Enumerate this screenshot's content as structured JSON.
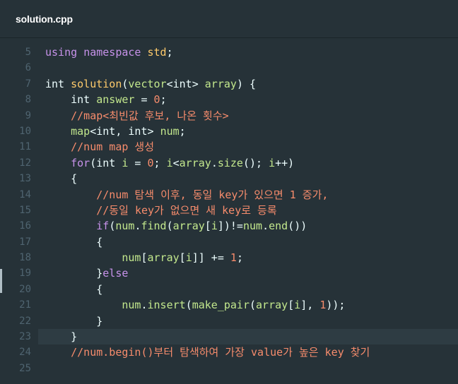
{
  "tab": {
    "title": "solution.cpp"
  },
  "colors": {
    "background": "#263238",
    "keyword": "#c792ea",
    "function": "#ffcb6b",
    "variable": "#c3e88d",
    "number": "#f78c6c",
    "comment": "#f78c6c",
    "line_number": "#4f6470"
  },
  "editor": {
    "current_line": "23",
    "lines": [
      {
        "n": "5",
        "tokens": [
          [
            "kw",
            "using"
          ],
          [
            "pl",
            " "
          ],
          [
            "kw",
            "namespace"
          ],
          [
            "pl",
            " "
          ],
          [
            "ns",
            "std"
          ],
          [
            "p",
            ";"
          ]
        ]
      },
      {
        "n": "6",
        "tokens": []
      },
      {
        "n": "7",
        "tokens": [
          [
            "type",
            "int"
          ],
          [
            "pl",
            " "
          ],
          [
            "fn",
            "solution"
          ],
          [
            "p",
            "("
          ],
          [
            "id",
            "vector"
          ],
          [
            "p",
            "<"
          ],
          [
            "type",
            "int"
          ],
          [
            "p",
            "> "
          ],
          [
            "id",
            "array"
          ],
          [
            "p",
            ") {"
          ]
        ]
      },
      {
        "n": "8",
        "tokens": [
          [
            "pl",
            "    "
          ],
          [
            "type",
            "int"
          ],
          [
            "pl",
            " "
          ],
          [
            "id",
            "answer"
          ],
          [
            "p",
            " = "
          ],
          [
            "num",
            "0"
          ],
          [
            "p",
            ";"
          ]
        ]
      },
      {
        "n": "9",
        "tokens": [
          [
            "pl",
            "    "
          ],
          [
            "cm",
            "//map<최빈값 후보, 나온 횟수>"
          ]
        ]
      },
      {
        "n": "10",
        "tokens": [
          [
            "pl",
            "    "
          ],
          [
            "id",
            "map"
          ],
          [
            "p",
            "<"
          ],
          [
            "type",
            "int"
          ],
          [
            "p",
            ", "
          ],
          [
            "type",
            "int"
          ],
          [
            "p",
            "> "
          ],
          [
            "id",
            "num"
          ],
          [
            "p",
            ";"
          ]
        ]
      },
      {
        "n": "11",
        "tokens": [
          [
            "pl",
            "    "
          ],
          [
            "cm",
            "//num map 생성"
          ]
        ]
      },
      {
        "n": "12",
        "tokens": [
          [
            "pl",
            "    "
          ],
          [
            "kw",
            "for"
          ],
          [
            "p",
            "("
          ],
          [
            "type",
            "int"
          ],
          [
            "pl",
            " "
          ],
          [
            "id",
            "i"
          ],
          [
            "p",
            " = "
          ],
          [
            "num",
            "0"
          ],
          [
            "p",
            "; "
          ],
          [
            "id",
            "i"
          ],
          [
            "p",
            "<"
          ],
          [
            "id",
            "array"
          ],
          [
            "p",
            "."
          ],
          [
            "id",
            "size"
          ],
          [
            "p",
            "(); "
          ],
          [
            "id",
            "i"
          ],
          [
            "p",
            "++)"
          ]
        ]
      },
      {
        "n": "13",
        "tokens": [
          [
            "pl",
            "    "
          ],
          [
            "p",
            "{"
          ]
        ]
      },
      {
        "n": "14",
        "tokens": [
          [
            "pl",
            "        "
          ],
          [
            "cm",
            "//num 탐색 이후, 동일 key가 있으면 1 증가,"
          ]
        ]
      },
      {
        "n": "15",
        "tokens": [
          [
            "pl",
            "        "
          ],
          [
            "cm",
            "//동일 key가 없으면 새 key로 등록"
          ]
        ]
      },
      {
        "n": "16",
        "tokens": [
          [
            "pl",
            "        "
          ],
          [
            "kw",
            "if"
          ],
          [
            "p",
            "("
          ],
          [
            "id",
            "num"
          ],
          [
            "p",
            "."
          ],
          [
            "id",
            "find"
          ],
          [
            "p",
            "("
          ],
          [
            "id",
            "array"
          ],
          [
            "p",
            "["
          ],
          [
            "id",
            "i"
          ],
          [
            "p",
            "])!="
          ],
          [
            "id",
            "num"
          ],
          [
            "p",
            "."
          ],
          [
            "id",
            "end"
          ],
          [
            "p",
            "())"
          ]
        ]
      },
      {
        "n": "17",
        "tokens": [
          [
            "pl",
            "        "
          ],
          [
            "p",
            "{"
          ]
        ]
      },
      {
        "n": "18",
        "tokens": [
          [
            "pl",
            "            "
          ],
          [
            "id",
            "num"
          ],
          [
            "p",
            "["
          ],
          [
            "id",
            "array"
          ],
          [
            "p",
            "["
          ],
          [
            "id",
            "i"
          ],
          [
            "p",
            "]] += "
          ],
          [
            "num",
            "1"
          ],
          [
            "p",
            ";"
          ]
        ]
      },
      {
        "n": "19",
        "tokens": [
          [
            "pl",
            "        "
          ],
          [
            "p",
            "}"
          ],
          [
            "kw",
            "else"
          ]
        ]
      },
      {
        "n": "20",
        "tokens": [
          [
            "pl",
            "        "
          ],
          [
            "p",
            "{"
          ]
        ]
      },
      {
        "n": "21",
        "tokens": [
          [
            "pl",
            "            "
          ],
          [
            "id",
            "num"
          ],
          [
            "p",
            "."
          ],
          [
            "id",
            "insert"
          ],
          [
            "p",
            "("
          ],
          [
            "id",
            "make_pair"
          ],
          [
            "p",
            "("
          ],
          [
            "id",
            "array"
          ],
          [
            "p",
            "["
          ],
          [
            "id",
            "i"
          ],
          [
            "p",
            "], "
          ],
          [
            "num",
            "1"
          ],
          [
            "p",
            "));"
          ]
        ]
      },
      {
        "n": "22",
        "tokens": [
          [
            "pl",
            "        "
          ],
          [
            "p",
            "}"
          ]
        ]
      },
      {
        "n": "23",
        "tokens": [
          [
            "pl",
            "    "
          ],
          [
            "p",
            "}"
          ]
        ]
      },
      {
        "n": "24",
        "tokens": [
          [
            "pl",
            "    "
          ],
          [
            "cm",
            "//num.begin()부터 탐색하여 가장 value가 높은 key 찾기"
          ]
        ]
      },
      {
        "n": "25",
        "tokens": []
      }
    ]
  }
}
